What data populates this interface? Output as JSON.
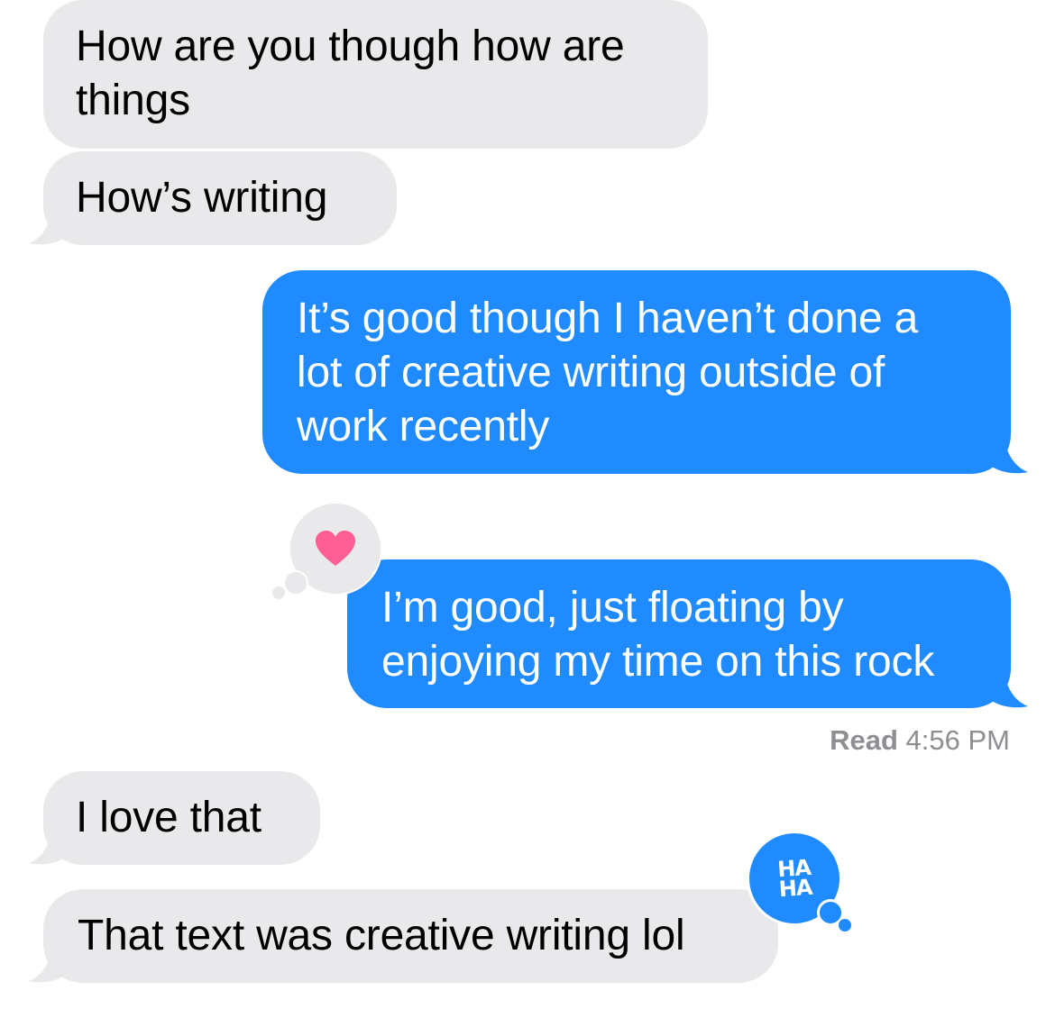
{
  "conversation": {
    "messages": [
      {
        "direction": "received",
        "text": "How are you though how are\nthings"
      },
      {
        "direction": "received",
        "text": "How’s writing"
      },
      {
        "direction": "sent",
        "text": "It’s good though I haven’t done a\nlot of creative writing outside of\nwork recently"
      },
      {
        "direction": "sent",
        "text": "I’m good, just floating by\nenjoying my time on this rock",
        "tapback": "heart"
      },
      {
        "direction": "received",
        "text": "I love that"
      },
      {
        "direction": "received",
        "text": "That text was creative writing lol",
        "tapback": "haha"
      }
    ],
    "read_receipt": {
      "label": "Read",
      "time": "4:56 PM"
    },
    "tapbacks": {
      "heart": {
        "icon": "heart-icon",
        "color": "#ff5e95"
      },
      "haha": {
        "icon": "haha-icon",
        "line1": "HA",
        "line2": "HA",
        "color": "#1f8bff"
      }
    }
  },
  "colors": {
    "sent_bubble": "#1f8bff",
    "received_bubble": "#e9e9eb",
    "status_text": "#8e8e93"
  }
}
